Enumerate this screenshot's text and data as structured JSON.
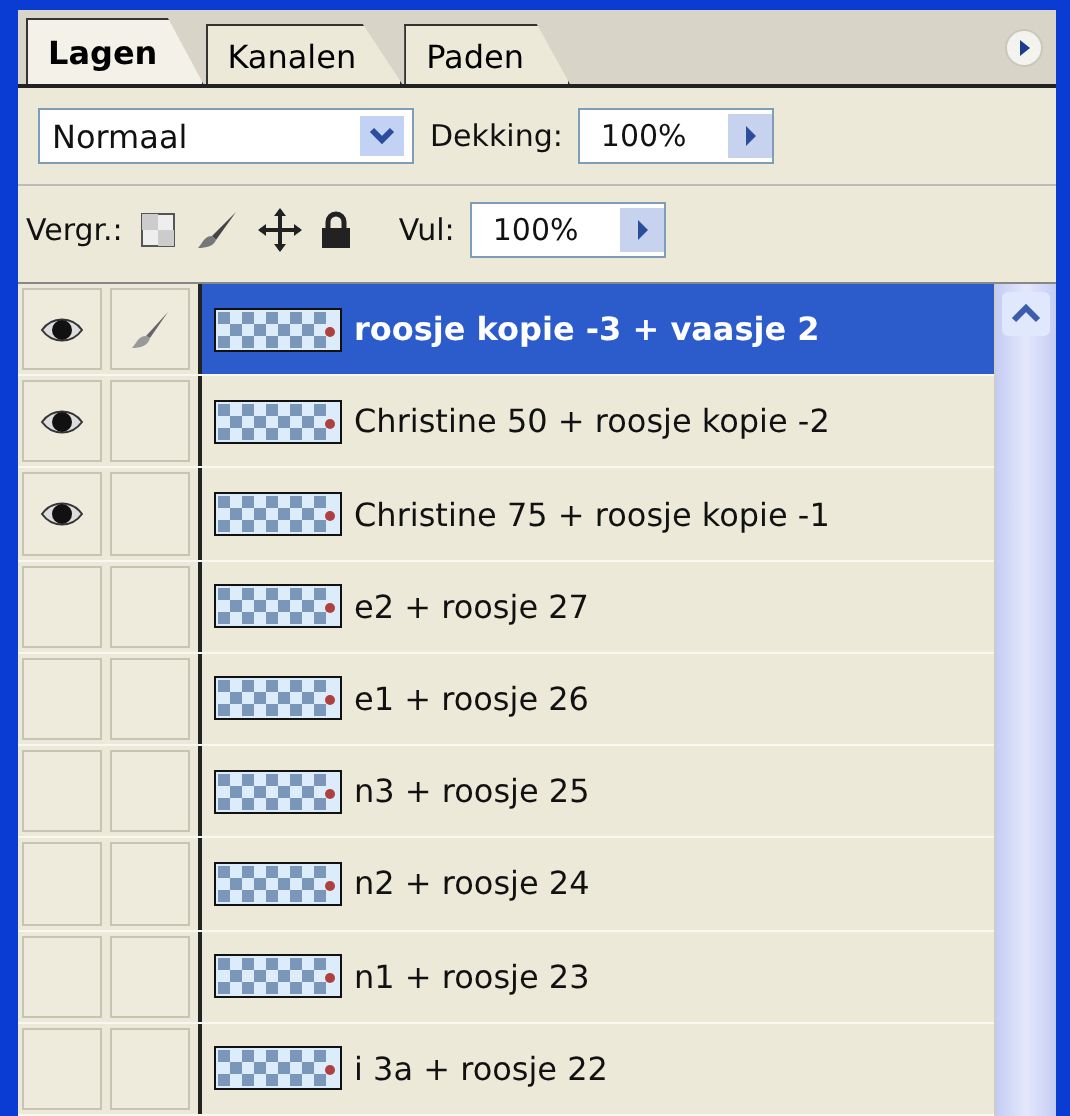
{
  "tabs": [
    {
      "label": "Lagen",
      "selected": true
    },
    {
      "label": "Kanalen",
      "selected": false
    },
    {
      "label": "Paden",
      "selected": false
    }
  ],
  "blend_mode": {
    "value": "Normaal"
  },
  "opacity": {
    "label": "Dekking:",
    "value": "100%"
  },
  "lock": {
    "label": "Vergr.:"
  },
  "fill": {
    "label": "Vul:",
    "value": "100%"
  },
  "layers": [
    {
      "name": "roosje kopie -3 + vaasje 2",
      "visible": true,
      "brush": true,
      "selected": true
    },
    {
      "name": "Christine 50 + roosje kopie  -2",
      "visible": true,
      "brush": false,
      "selected": false
    },
    {
      "name": "Christine 75 + roosje kopie  -1",
      "visible": true,
      "brush": false,
      "selected": false
    },
    {
      "name": "e2 + roosje 27",
      "visible": false,
      "brush": false,
      "selected": false
    },
    {
      "name": "e1 + roosje 26",
      "visible": false,
      "brush": false,
      "selected": false
    },
    {
      "name": "n3 + roosje 25",
      "visible": false,
      "brush": false,
      "selected": false
    },
    {
      "name": "n2 + roosje 24",
      "visible": false,
      "brush": false,
      "selected": false
    },
    {
      "name": "n1 + roosje 23",
      "visible": false,
      "brush": false,
      "selected": false
    },
    {
      "name": "i 3a + roosje 22",
      "visible": false,
      "brush": false,
      "selected": false
    }
  ]
}
